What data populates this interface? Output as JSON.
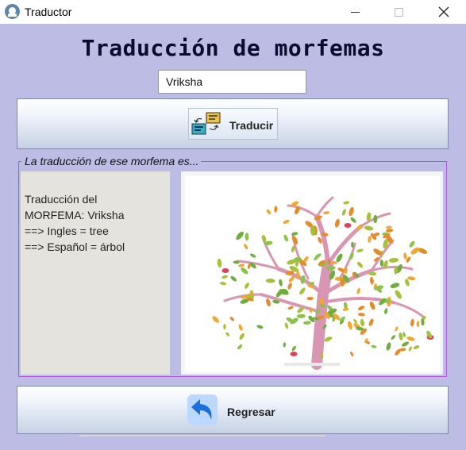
{
  "window": {
    "title": "Traductor",
    "app_icon": "user-icon",
    "controls": [
      "minimize-icon",
      "maximize-icon",
      "close-icon"
    ]
  },
  "header": {
    "title": "Traducción de morfemas"
  },
  "input": {
    "value": "Vriksha"
  },
  "translate_button": {
    "label": "Traducir",
    "icon": "translate-icon"
  },
  "result_group": {
    "legend": "La traducción de ese morfema es...",
    "lines": [
      "Traducción del",
      "MORFEMA: Vriksha",
      "==> Ingles = tree",
      "==> Español = árbol"
    ],
    "image": "tree-illustration"
  },
  "back_button": {
    "label": "Regresar",
    "icon": "back-arrow-icon"
  },
  "colors": {
    "background": "#bcbce4",
    "group_border": "#b055d8",
    "trunk": "#d996b2",
    "leaf_green": "#8bc34a",
    "leaf_orange": "#f0a830",
    "accent_blue": "#1e6fd9"
  }
}
